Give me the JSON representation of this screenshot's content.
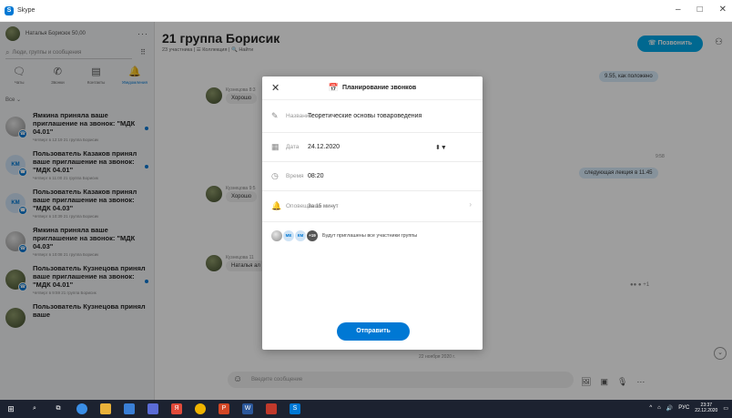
{
  "window": {
    "title": "Skype",
    "controls": [
      "–",
      "□",
      "✕"
    ]
  },
  "sidebar": {
    "profile_name": "Наталья Борисюк  50,00",
    "search_placeholder": "Люди, группы и сообщения",
    "tabs": [
      {
        "label": "Чаты",
        "icon": "chat-icon"
      },
      {
        "label": "Звонки",
        "icon": "phone-icon"
      },
      {
        "label": "Контакты",
        "icon": "contacts-icon"
      },
      {
        "label": "Уведомления",
        "icon": "bell-icon"
      }
    ],
    "filter_label": "Все ⌄",
    "notifications": [
      {
        "title": "Ямкина приняла ваше приглашение на звонок: \"МДК 04.01\"",
        "meta": "Четверг в 12:19  21 группа Борисик"
      },
      {
        "title": "Пользователь Казаков принял ваше приглашение на звонок: \"МДК 04.01\"",
        "meta": "Четверг в 11:00  21 группа Борисик",
        "initials": "KM"
      },
      {
        "title": "Пользователь Казаков принял ваше приглашение на звонок: \"МДК 04.03\"",
        "meta": "Четверг в 10:39  21 группа Борисик",
        "initials": "KM"
      },
      {
        "title": "Ямкина приняла ваше приглашение на звонок: \"МДК 04.03\"",
        "meta": "Четверг в 10:08  21 группа Борисик"
      },
      {
        "title": "Пользователь Кузнецова принял ваше приглашение на звонок: \"МДК 04.01\"",
        "meta": "Четверг в 9:59  21 группа Борисик"
      },
      {
        "title": "Пользователь Кузнецова принял ваше",
        "meta": ""
      }
    ]
  },
  "chat": {
    "title": "21 группа Борисик",
    "subtitle": "23 участника  |  ☰ Коллекция  |  🔍 Найти",
    "call_label": "Позвонить",
    "messages": {
      "out1": "9.55, как положено",
      "out2": "следующая лекция в 11.45",
      "sender1": "Кузнецова 8:3",
      "in1": "Хорошо",
      "sender2": "Кузнецова 9:5",
      "in2": "Хорошо",
      "sender3": "Кузнецова 11",
      "in3": "Наталья ал",
      "time1": "9:58",
      "reactions": "+1"
    },
    "date_divider": "22 ноября 2020 г.",
    "composer_placeholder": "Введите сообщение"
  },
  "dialog": {
    "title": "Планирование звонков",
    "name_label": "Название",
    "name_value": "Теоретические основы товароведения",
    "date_label": "Дата",
    "date_value": "24.12.2020",
    "time_label": "Время",
    "time_value": "08:20",
    "reminder_label": "Оповещение",
    "reminder_value": "За 15 минут",
    "invite_avatars": [
      "МЕ",
      "КМ",
      "+19"
    ],
    "invite_text": "Будут приглашены все участники группы",
    "send_label": "Отправить"
  },
  "taskbar": {
    "lang": "РУС",
    "time": "23:37",
    "date": "22.12.2020"
  }
}
